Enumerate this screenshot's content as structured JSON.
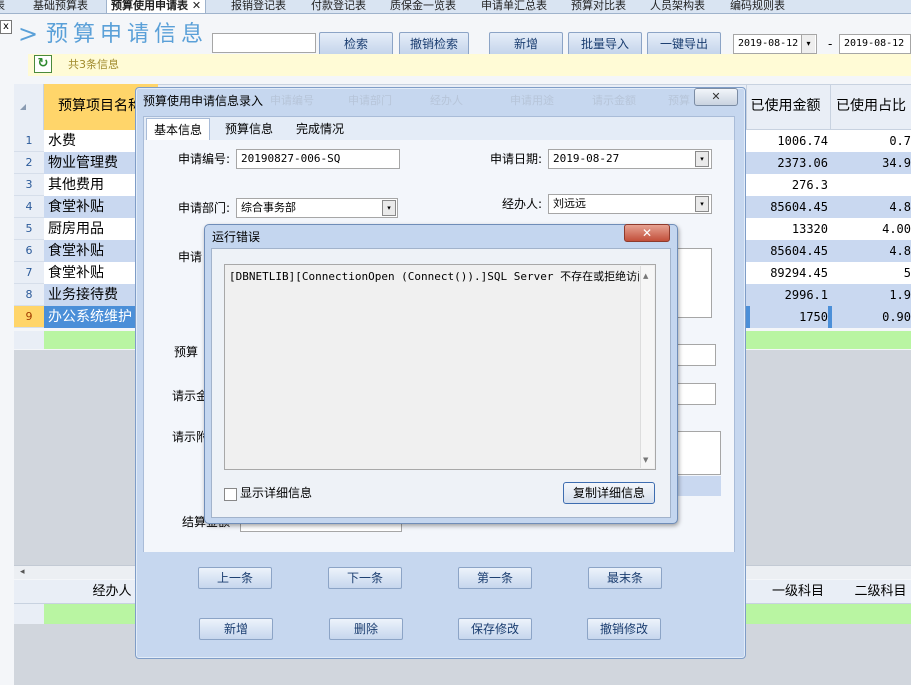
{
  "top_tabs": [
    {
      "label": "表"
    },
    {
      "label": "基础预算表"
    },
    {
      "label": "预算使用申请表 ✕",
      "active": true
    },
    {
      "label": "报销登记表"
    },
    {
      "label": "付款登记表"
    },
    {
      "label": "质保金一览表"
    },
    {
      "label": "申请单汇总表"
    },
    {
      "label": "预算对比表"
    },
    {
      "label": "人员架构表"
    },
    {
      "label": "编码规则表"
    }
  ],
  "header": {
    "close_glyph": "x",
    "arrow": ">",
    "title": "预算申请信息",
    "search_value": "",
    "buttons": {
      "search": "检索",
      "cancel_search": "撤销检索",
      "add": "新增",
      "batch_import": "批量导入",
      "export": "一键导出"
    },
    "date_from": "2019-08-12",
    "date_separator": "-",
    "date_to": "2019-08-12"
  },
  "info": {
    "refresh_glyph": "↻",
    "count_text": "共3条信息"
  },
  "grid": {
    "first_column": "预算项目名称",
    "columns": [
      "已使用金额",
      "已使用占比"
    ],
    "rows": [
      {
        "n": "1",
        "name": "水费",
        "amount": "1006.74",
        "pct": "0.7"
      },
      {
        "n": "2",
        "name": "物业管理费",
        "amount": "2373.06",
        "pct": "34.9"
      },
      {
        "n": "3",
        "name": "其他费用",
        "amount": "276.3",
        "pct": ""
      },
      {
        "n": "4",
        "name": "食堂补贴",
        "amount": "85604.45",
        "pct": "4.8"
      },
      {
        "n": "5",
        "name": "厨房用品",
        "amount": "13320",
        "pct": "4.00"
      },
      {
        "n": "6",
        "name": "食堂补贴",
        "amount": "85604.45",
        "pct": "4.8"
      },
      {
        "n": "7",
        "name": "食堂补贴",
        "amount": "89294.45",
        "pct": "5"
      },
      {
        "n": "8",
        "name": "业务接待费",
        "amount": "2996.1",
        "pct": "1.9"
      },
      {
        "n": "9",
        "name": "办公系统维护",
        "amount": "1750",
        "pct": "0.90"
      }
    ]
  },
  "lower_grid": {
    "scroll_left_glyph": "◂",
    "columns": {
      "handler": "经办人",
      "level1": "一级科目",
      "level2": "二级科目"
    }
  },
  "entry_dialog": {
    "title": "预算使用申请信息录入",
    "ghost_headers": [
      "申请编号",
      "申请部门",
      "经办人",
      "申请用途",
      "请示金额",
      "预算"
    ],
    "close_glyph": "✕",
    "tabs": [
      "基本信息",
      "预算信息",
      "完成情况"
    ],
    "fields": {
      "apply_no_label": "申请编号:",
      "apply_no_value": "20190827-006-SQ",
      "apply_date_label": "申请日期:",
      "apply_date_value": "2019-08-27",
      "dept_label": "申请部门:",
      "dept_value": "综合事务部",
      "handler_label": "经办人:",
      "handler_value": "刘远远",
      "purpose_label": "申请",
      "budget_label": "预算",
      "request_amount_label": "请示金",
      "request_note_label": "请示附",
      "settle_label": "结算金额"
    },
    "nav_buttons": {
      "prev": "上一条",
      "next": "下一条",
      "first": "第一条",
      "last": "最末条",
      "add": "新增",
      "delete": "删除",
      "save": "保存修改",
      "undo": "撤销修改"
    },
    "drop_glyph": "▾"
  },
  "error_dialog": {
    "title": "运行错误",
    "close_glyph": "✕",
    "message": "[DBNETLIB][ConnectionOpen (Connect()).]SQL Server 不存在或拒绝访问。",
    "scroll_up": "▲",
    "scroll_down": "▼",
    "show_details": "显示详细信息",
    "copy_details": "复制详细信息"
  }
}
